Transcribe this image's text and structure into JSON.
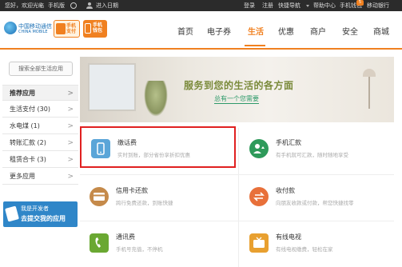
{
  "topbar": {
    "welcome": "您好，欢迎光临",
    "mobile": "手机版",
    "enter_personal": "进入日期",
    "login": "登录",
    "register": "注册",
    "quick_links": "快捷导航",
    "help_center": "帮助中心",
    "mobile_wallet": "手机钱包",
    "mobile_wallet_badge": "5",
    "mobile_app": "移动银行",
    "icons": [
      "gear-icon",
      "person-icon"
    ]
  },
  "header": {
    "logo_cn": "中国移动通信",
    "logo_en": "CHINA MOBILE",
    "badge1": "手机支付",
    "badge2": "手机钱包"
  },
  "nav": {
    "items": [
      "首页",
      "电子券",
      "生活",
      "优惠",
      "商户",
      "安全",
      "商城"
    ],
    "active": "生活"
  },
  "sidebar": {
    "search_button": "搜索全部生活应用",
    "items": [
      {
        "label": "推荐应用",
        "count": "",
        "arrow": ">"
      },
      {
        "label": "生活支付",
        "count": "(30)",
        "arrow": ">"
      },
      {
        "label": "水电煤",
        "count": "(1)",
        "arrow": ">"
      },
      {
        "label": "转账汇款",
        "count": "(2)",
        "arrow": ">"
      },
      {
        "label": "租赁合卡",
        "count": "(3)",
        "arrow": ">"
      },
      {
        "label": "更多应用",
        "count": "",
        "arrow": ">"
      }
    ],
    "promo": {
      "line1": "我是开发者",
      "line2": "去提交我的应用"
    }
  },
  "banner": {
    "title": "服务到您的生活的各方面",
    "link": "总有一个您需要"
  },
  "services": [
    {
      "name": "缴话费",
      "desc": "实时到账，部分省份享折扣优惠",
      "icon": "phone-bill-icon",
      "color": "#5aa5d8"
    },
    {
      "name": "手机汇款",
      "desc": "有手机就可汇款，随时随地享受",
      "icon": "money-transfer-icon",
      "color": "#2e9a5a"
    },
    {
      "name": "信用卡还款",
      "desc": "跨行免费还款，到账快捷",
      "icon": "credit-card-icon",
      "color": "#c58a4a"
    },
    {
      "name": "收付款",
      "desc": "向朋友收款或付款，帮您快捷找零",
      "icon": "exchange-icon",
      "color": "#e8703a"
    },
    {
      "name": "通讯费",
      "desc": "手机号充值，不停机",
      "icon": "telecom-icon",
      "color": "#6aa832"
    },
    {
      "name": "有线电视",
      "desc": "有线电视缴费，轻松在家",
      "icon": "tv-icon",
      "color": "#e8a030"
    }
  ]
}
